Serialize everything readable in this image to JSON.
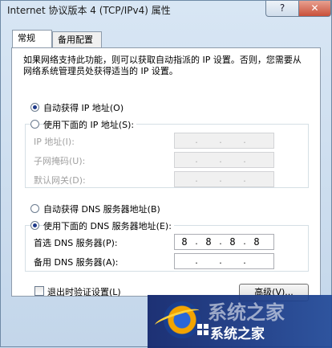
{
  "window": {
    "title": "Internet 协议版本 4 (TCP/IPv4) 属性",
    "help_label": "?",
    "close_label": "✕"
  },
  "tabs": [
    {
      "label": "常规",
      "active": true
    },
    {
      "label": "备用配置",
      "active": false
    }
  ],
  "description": "如果网络支持此功能，则可以获取自动指派的 IP 设置。否则，您需要从网络系统管理员处获得适当的 IP 设置。",
  "ip_section": {
    "auto_label": "自动获得 IP 地址(O)",
    "auto_selected": true,
    "manual_label": "使用下面的 IP 地址(S):",
    "manual_selected": false,
    "fields": [
      {
        "label": "IP 地址(I):",
        "value": [
          "",
          "",
          "",
          ""
        ]
      },
      {
        "label": "子网掩码(U):",
        "value": [
          "",
          "",
          "",
          ""
        ]
      },
      {
        "label": "默认网关(D):",
        "value": [
          "",
          "",
          "",
          ""
        ]
      }
    ]
  },
  "dns_section": {
    "auto_label": "自动获得 DNS 服务器地址(B)",
    "auto_selected": false,
    "manual_label": "使用下面的 DNS 服务器地址(E):",
    "manual_selected": true,
    "fields": [
      {
        "label": "首选 DNS 服务器(P):",
        "value": [
          "8",
          "8",
          "8",
          "8"
        ]
      },
      {
        "label": "备用 DNS 服务器(A):",
        "value": [
          "",
          "",
          "",
          ""
        ]
      }
    ]
  },
  "validate_on_exit": {
    "label": "退出时验证设置(L)",
    "checked": false
  },
  "advanced_button": "高级(V)...",
  "watermark": {
    "text": "系统之家",
    "back_text": "系统之家"
  },
  "colors": {
    "selected_radio": "#1f3a8a",
    "watermark_bg": "#1e4696"
  }
}
